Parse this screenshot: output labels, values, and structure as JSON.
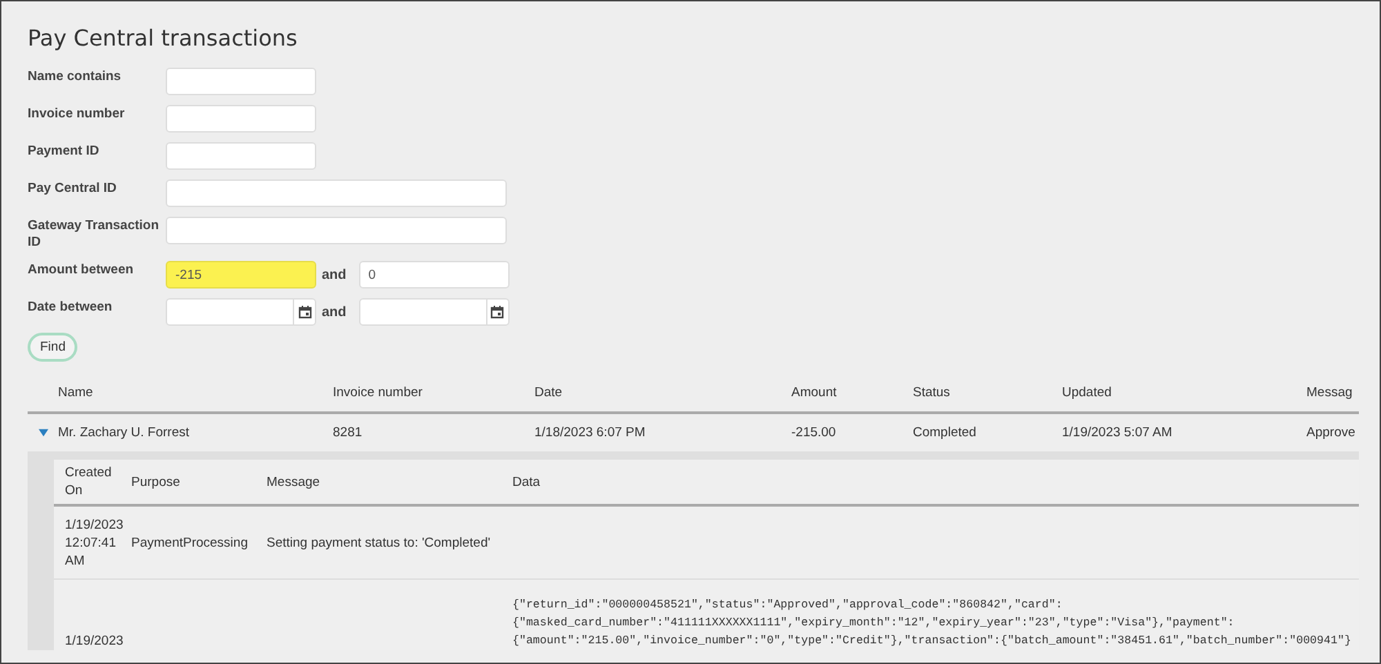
{
  "title": "Pay Central transactions",
  "filters": [
    {
      "kind": "text",
      "label": "Name contains"
    },
    {
      "kind": "text",
      "label": "Invoice number"
    },
    {
      "kind": "text",
      "label": "Payment ID"
    },
    {
      "kind": "wide",
      "label": "Pay Central ID"
    },
    {
      "kind": "wide",
      "label": "Gateway Transaction ID"
    },
    {
      "kind": "range",
      "label": "Amount between",
      "joiner": "and",
      "from": {
        "value": "-215",
        "highlighted": true
      },
      "to": {
        "value": "0",
        "highlighted": false
      }
    },
    {
      "kind": "daterange",
      "label": "Date between",
      "joiner": "and"
    }
  ],
  "find_button": "Find",
  "table": {
    "columns": [
      "Name",
      "Invoice number",
      "Date",
      "Amount",
      "Status",
      "Updated",
      "Messag"
    ],
    "rows": [
      {
        "expanded": true,
        "cells": [
          "Mr. Zachary U. Forrest",
          "8281",
          "1/18/2023 6:07 PM",
          "-215.00",
          "Completed",
          "1/19/2023 5:07 AM",
          "Approve"
        ],
        "detail": {
          "columns": [
            "Created On",
            "Purpose",
            "Message",
            "Data"
          ],
          "rows": [
            {
              "created_on": "1/19/2023 12:07:41 AM",
              "purpose": "PaymentProcessing",
              "message": "Setting payment status to: 'Completed'"
            },
            {
              "created_on": "1/19/2023",
              "data": [
                "{\"return_id\":\"000000458521\",\"status\":\"Approved\",\"approval_code\":\"860842\",\"card\":",
                "{\"masked_card_number\":\"411111XXXXXX1111\",\"expiry_month\":\"12\",\"expiry_year\":\"23\",\"type\":\"Visa\"},\"payment\":",
                "{\"amount\":\"215.00\",\"invoice_number\":\"0\",\"type\":\"Credit\"},\"transaction\":{\"batch_amount\":\"38451.61\",\"batch_number\":\"000941\"}"
              ]
            }
          ]
        }
      }
    ]
  }
}
